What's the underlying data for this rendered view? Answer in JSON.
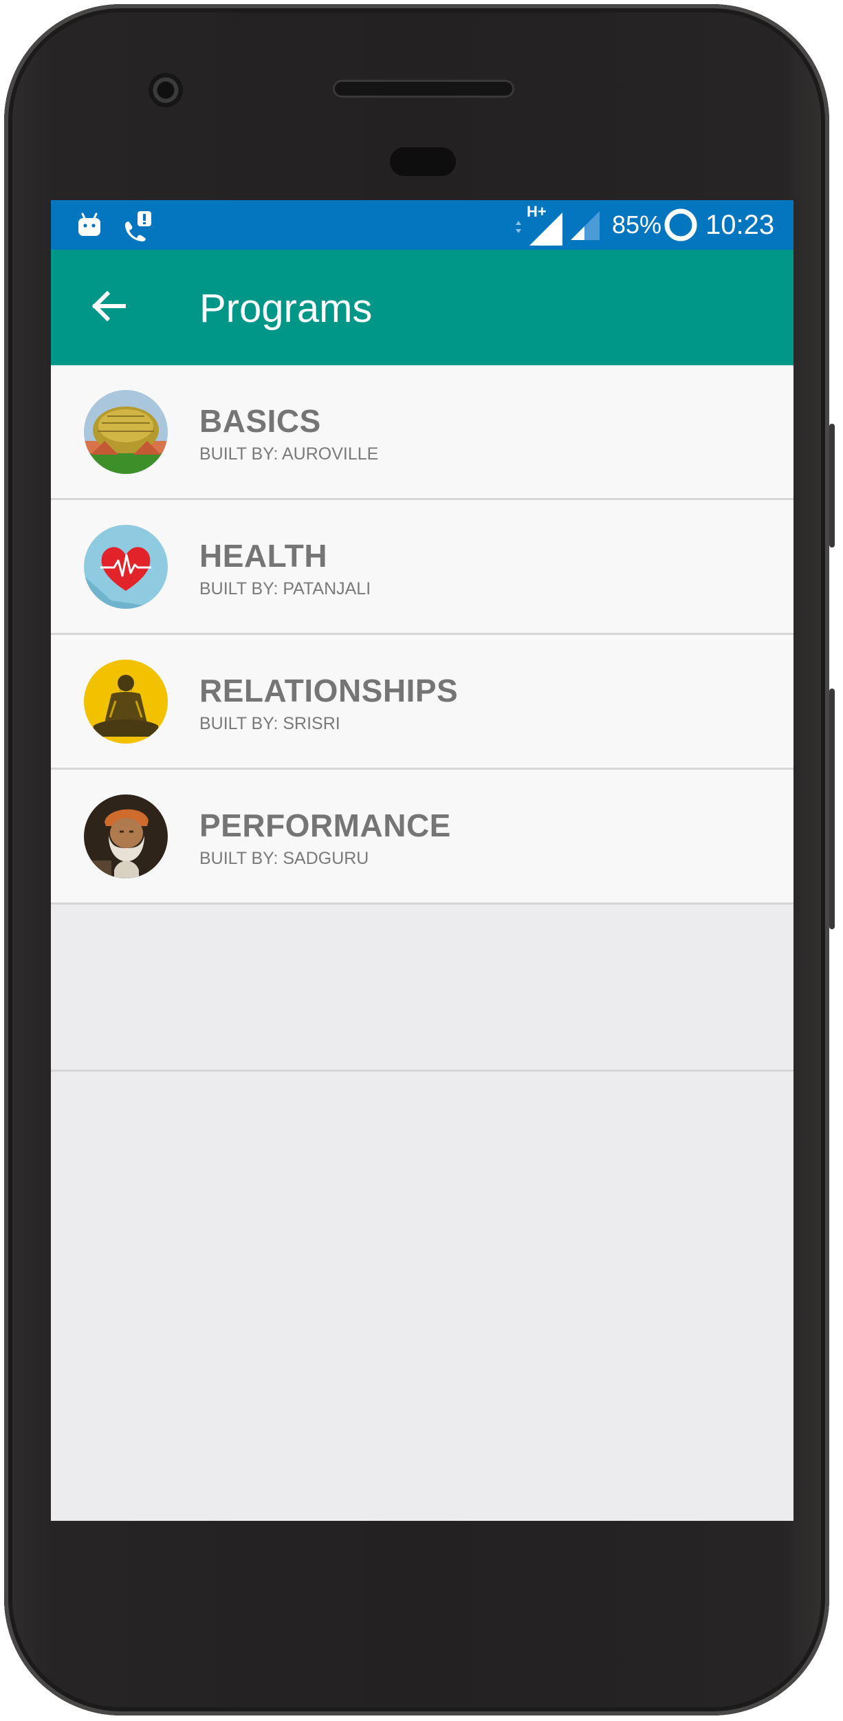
{
  "status_bar": {
    "icons": [
      "android-debug-icon",
      "wifi-calling-alert-icon",
      "hplus-data-icon",
      "signal-strength-icon",
      "signal-strength-2-icon",
      "battery-saver-icon"
    ],
    "network_label": "H+",
    "battery": "85%",
    "time": "10:23"
  },
  "app_bar": {
    "back_icon": "arrow-back-icon",
    "title": "Programs"
  },
  "programs": [
    {
      "title": "BASICS",
      "subtitle": "BUILT BY: AUROVILLE",
      "avatar": "matrimandir-image"
    },
    {
      "title": "HEALTH",
      "subtitle": "BUILT BY: PATANJALI",
      "avatar": "heartbeat-icon"
    },
    {
      "title": "RELATIONSHIPS",
      "subtitle": "BUILT BY: SRISRI",
      "avatar": "guru-portrait-image"
    },
    {
      "title": "PERFORMANCE",
      "subtitle": "BUILT BY: SADGURU",
      "avatar": "sadguru-portrait-image"
    }
  ],
  "colors": {
    "status_bar": "#0475bf",
    "app_bar": "#009688",
    "list_background": "#f8f8f8",
    "screen_background": "#ececee",
    "divider": "#d6d6d6",
    "item_title": "#757575"
  }
}
